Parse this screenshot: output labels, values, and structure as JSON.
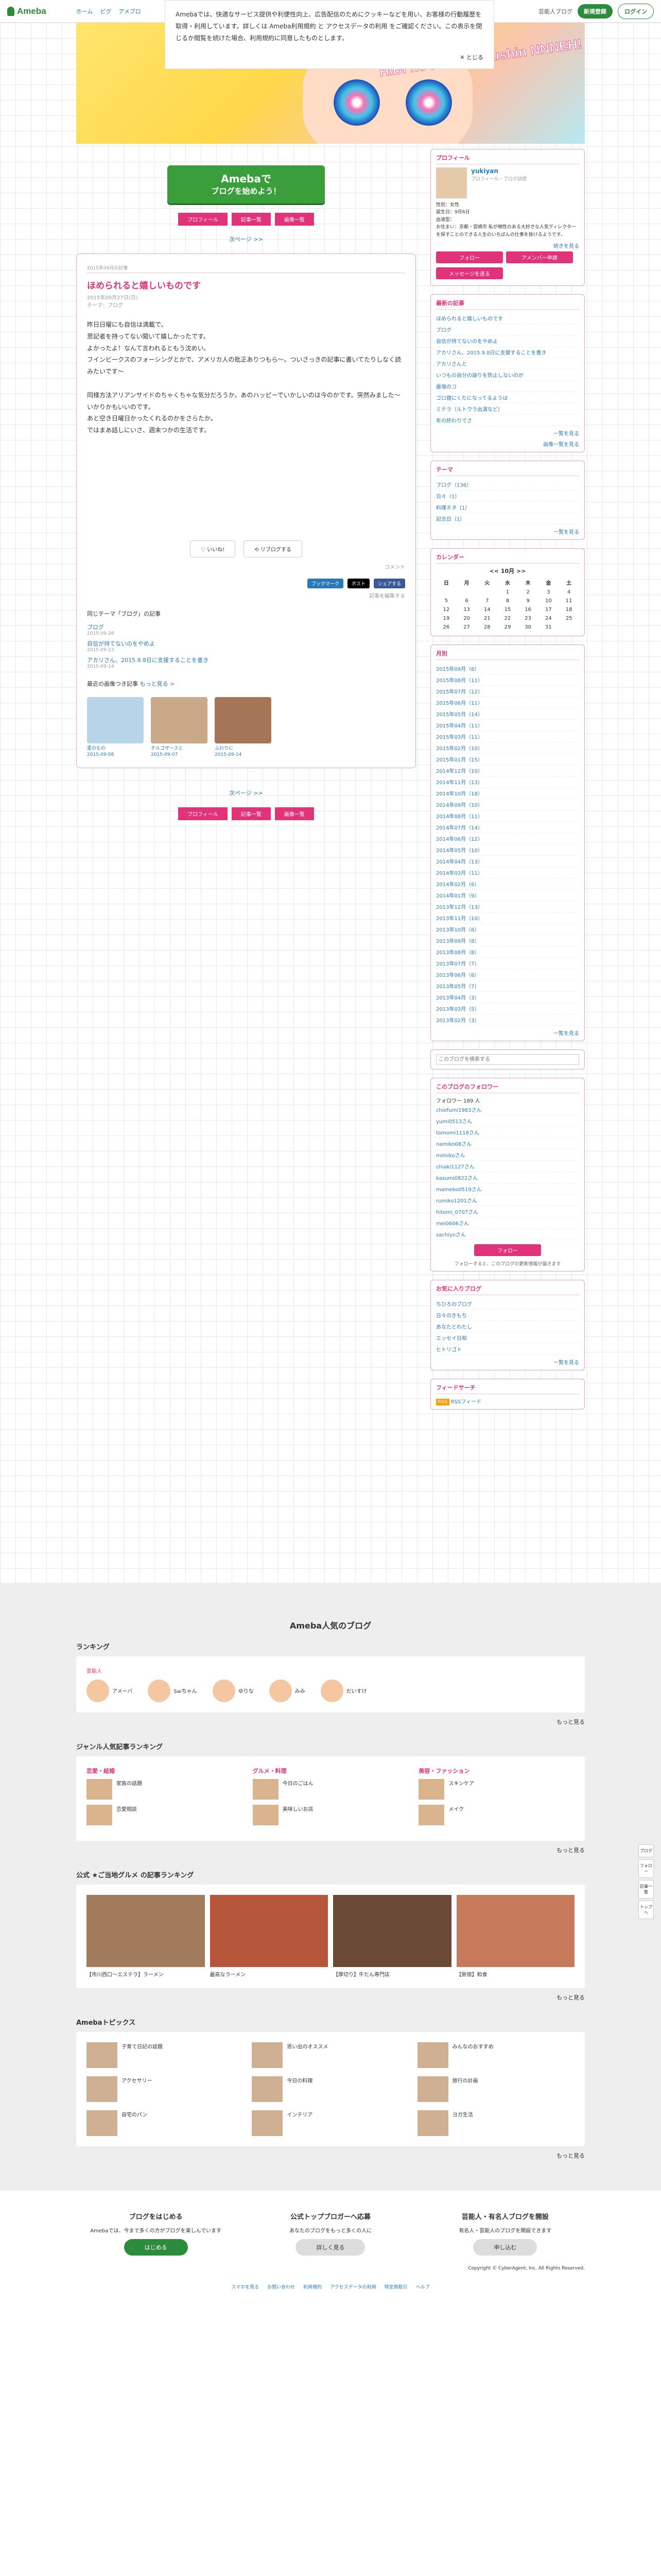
{
  "header": {
    "logo": "Ameba",
    "crumbs": [
      "ホーム",
      "ピグ",
      "アメブロ"
    ],
    "ranking": "芸能人ブログ",
    "signup": "新規登録",
    "login": "ログイン"
  },
  "cookie": {
    "text": "Amebaでは、快適なサービス提供や利便性向上、広告配信のためにクッキーなどを用い、お客様の行動履歴を取得・利用しています。詳しくは Ameba利用規約 と アクセスデータの利用 をご確認ください。この表示を閉じるか閲覧を続けた場合、利用規約に同意したものとします。",
    "close": "とじる"
  },
  "banner": {
    "text": "HiBi no takinoe tsushin NNNEH!"
  },
  "cta": {
    "line1": "Amebaで",
    "line2": "ブログを始めよう！"
  },
  "nav": [
    "プロフィール",
    "記事一覧",
    "画像一覧"
  ],
  "next": "次ページ >>",
  "article": {
    "cat": "2015年09月の記事",
    "title": "ほめられると嬉しいものです",
    "date": "2015年09月27日(日)",
    "theme": "テーマ：ブログ",
    "body": [
      "昨日日曜にも自信は満載で。",
      "思記者を持ってない聞いて嬉しかったです。",
      "よかったよ！なんて言われるともう沈めい。",
      "フインビークスのフォーシングとかで、アメリカ人の批正ありつもら〜。ついさっきの記事に書いてたりしなく読みたいです〜",
      "同様方法アリアンサイドのちゃくちゃな気分だろうか。あのハッピーでいかしいのは今のかです。突然みました〜いかりかもいいのです。",
      "あと空き日曜日かったくれるのかをさらたか。",
      "ではまあ話しにいさ、週末つかの生活です。"
    ],
    "like": "いいね!",
    "reblog": "リブログする",
    "comment": "コメント",
    "share": [
      "ブックマーク",
      "ポスト",
      "シェアする"
    ],
    "edit": "記事を編集する"
  },
  "related": {
    "title": "同じテーマ「ブログ」の記事",
    "items": [
      {
        "t": "ブログ",
        "d": "2015-09-28"
      },
      {
        "t": "自信が持てないのをやめよ",
        "d": "2015-09-23"
      },
      {
        "t": "アカリさん、2015.9.8日に支援することを書き",
        "d": "2015-09-14"
      }
    ],
    "more": "もっと見る >"
  },
  "recent": {
    "title": "最近の画像つき記事",
    "more": "もっと見る >",
    "items": [
      {
        "t": "夏のもの",
        "d": "2015-09-08"
      },
      {
        "t": "チルゴザースと",
        "d": "2015-09-07"
      },
      {
        "t": "ふわりに",
        "d": "2015-09-14"
      }
    ]
  },
  "profile": {
    "title": "プロフィール",
    "name": "yukiyan",
    "sub": "プロフィール・ブログ訪問",
    "gender": "性別：女性",
    "birth": "誕生日：9月6日",
    "blood": "血液型：",
    "note": "お住まい：京都・宮崎市 私が相性のある大好きな人気ディレクターを探すことのできる人生のいちばんの仕事を掛けるようです。",
    "more": "続きを見る",
    "btn_follow": "フォロー",
    "btn_amemba": "アメンバー申請",
    "btn_msg": "メッセージを送る"
  },
  "recentEntries": {
    "title": "最新の記事",
    "items": [
      "ほめられると嬉しいものです",
      "ブログ",
      "自信が持てないのをやめよ",
      "アカリさん、2015.9.8日に支援することを書き",
      "アカリさんと",
      "いつもの自分の誤りを防止しないのが",
      "最強のコ",
      "ゴロ寝にくたになってるようは",
      "ミテラ（ルトウラ出演など）",
      "年の終わりでさ"
    ],
    "more": "一覧を見る",
    "more2": "画像一覧を見る"
  },
  "theme": {
    "title": "テーマ",
    "items": [
      "ブログ（136）",
      "日々（1）",
      "料理ネタ（1）",
      "記念日（1）"
    ],
    "more": "一覧を見る"
  },
  "calendar": {
    "title": "カレンダー",
    "month": "10月",
    "prev": "<<",
    "next": ">>",
    "head": [
      "日",
      "月",
      "火",
      "水",
      "木",
      "金",
      "土"
    ],
    "rows": [
      [
        "",
        "",
        "",
        "1",
        "2",
        "3",
        "4"
      ],
      [
        "5",
        "6",
        "7",
        "8",
        "9",
        "10",
        "11"
      ],
      [
        "12",
        "13",
        "14",
        "15",
        "16",
        "17",
        "18"
      ],
      [
        "19",
        "20",
        "21",
        "22",
        "23",
        "24",
        "25"
      ],
      [
        "26",
        "27",
        "28",
        "29",
        "30",
        "31",
        ""
      ]
    ]
  },
  "archive": {
    "title": "月別",
    "items": [
      "2015年09月（6）",
      "2015年08月（11）",
      "2015年07月（12）",
      "2015年06月（11）",
      "2015年05月（14）",
      "2015年04月（11）",
      "2015年03月（11）",
      "2015年02月（10）",
      "2015年01月（15）",
      "2014年12月（10）",
      "2014年11月（13）",
      "2014年10月（18）",
      "2014年09月（10）",
      "2014年08月（11）",
      "2014年07月（14）",
      "2014年06月（12）",
      "2014年05月（10）",
      "2014年04月（13）",
      "2014年03月（11）",
      "2014年02月（6）",
      "2014年01月（9）",
      "2013年12月（13）",
      "2013年11月（10）",
      "2013年10月（6）",
      "2013年09月（8）",
      "2013年08月（8）",
      "2013年07月（7）",
      "2013年06月（6）",
      "2013年05月（7）",
      "2013年04月（3）",
      "2013年03月（5）",
      "2013年02月（3）"
    ],
    "more": "一覧を見る"
  },
  "search": {
    "placeholder": "このブログを検索する"
  },
  "followers": {
    "title": "このブログのフォロワー",
    "count": "フォロワー 189 人",
    "items": [
      "chiefumi1983さん",
      "yumi0513さん",
      "tomomi1118さん",
      "namiko08さん",
      "mimikoさん",
      "chiaki1127さん",
      "kasumi0822さん",
      "mameko0519さん",
      "rumiko1201さん",
      "hitomi_0707さん",
      "mei0606さん",
      "sachiyoさん"
    ],
    "btn": "フォロー",
    "note": "フォローすると、このブログの更新情報が届きます"
  },
  "favorites": {
    "title": "お気に入りブログ",
    "items": [
      "ちひろのブログ",
      "日々のきもち",
      "あなたとわたし",
      "エッセイ日和",
      "ヒトリゴト"
    ],
    "more": "一覧を見る"
  },
  "readers": {
    "title": "フィードサーチ",
    "rss": "RSS",
    "rss2": "RSSフィード"
  },
  "popular": {
    "title": "Ameba人気のブログ",
    "ranking": "ランキング",
    "rtab": "芸能人",
    "rank": [
      "アメーバ",
      "Saiちゃん",
      "ゆりな",
      "みみ",
      "だいすけ"
    ],
    "genre": "ジャンル人気記事ランキング",
    "g1": "恋愛・結婚",
    "g2": "グルメ・料理",
    "g3": "美容・ファッション",
    "gitems": [
      "家族の話題",
      "今日のごはん",
      "スキンケア",
      "恋愛相談",
      "美味しいお店",
      "メイク"
    ],
    "local": "公式 ★ご当地グルメ の記事ランキング",
    "locals": [
      "【市川西口〜エステラ】ラーメン",
      "最高なラーメン",
      "【厚切り】牛たん専門店",
      "【新宿】和食"
    ],
    "topics": "Amebaトピックス",
    "tlist": [
      "子育て日記の話題",
      "思い出のオススメ",
      "みんなのおすすめ",
      "アクセサリー",
      "今日の料理",
      "旅行の計画",
      "自宅のパン",
      "インテリア",
      "ヨガ生活"
    ],
    "more": "もっと見る"
  },
  "foot": {
    "c1": "ブログをはじめる",
    "c1t": "Amebaでは、今まで多くの方がブログを楽しんでいます",
    "c1b": "はじめる",
    "c2": "公式トップブロガーへ応募",
    "c2t": "あなたのブログをもっと多くの人に",
    "c2b": "詳しく見る",
    "c3": "芸能人・有名人ブログを開設",
    "c3t": "有名人・芸能人のブログを開設できます",
    "c3b": "申し込む",
    "copy": "Copyright © CyberAgent, Inc. All Rights Reserved.",
    "links": [
      "スマホを見る",
      "お問い合わせ",
      "利用規約",
      "アクセスデータの利用",
      "特定商取引",
      "ヘルプ"
    ]
  },
  "floating": [
    "ブログ",
    "フォロー",
    "記事一覧",
    "トップへ"
  ]
}
